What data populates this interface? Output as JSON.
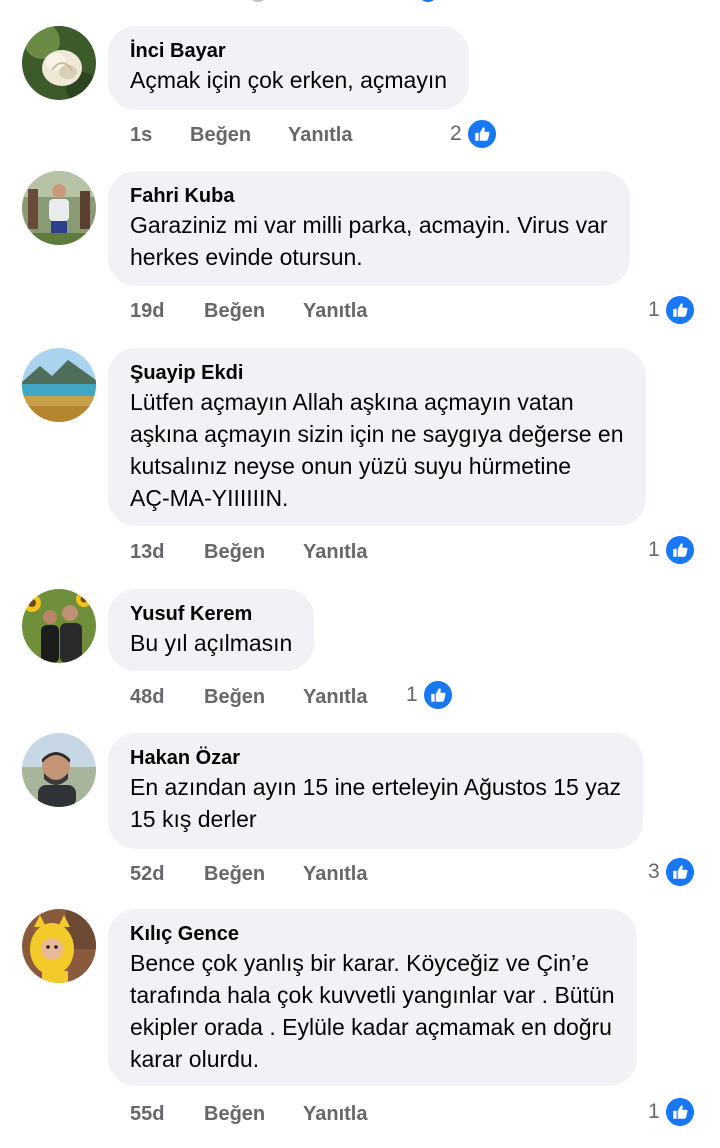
{
  "actions": {
    "like_label": "Beğen",
    "reply_label": "Yanıtla"
  },
  "colors": {
    "bubble_bg": "#f0f2f5",
    "meta_text": "#65676b",
    "like_blue": "#1877f2"
  },
  "comments": [
    {
      "author": "İnci Bayar",
      "avatar_icon": "rose-avatar",
      "lines": [
        "Açmak için çok erken, açmayın"
      ],
      "time": "1s",
      "reactions": "2"
    },
    {
      "author": "Fahri Kuba",
      "avatar_icon": "man-in-garden-avatar",
      "lines": [
        "Garaziniz mi var milli parka, acmayin. Virus var",
        "herkes evinde otursun."
      ],
      "time": "19d",
      "reactions": "1"
    },
    {
      "author": "Şuayip Ekdi",
      "avatar_icon": "lake-landscape-avatar",
      "lines": [
        "Lütfen açmayın Allah aşkına açmayın vatan",
        "aşkına açmayın sizin için ne saygıya değerse en",
        "kutsalınız neyse onun yüzü suyu hürmetine",
        "AÇ-MA-YIIIIIIN."
      ],
      "time": "13d",
      "reactions": "1"
    },
    {
      "author": "Yusuf Kerem",
      "avatar_icon": "sunflower-couple-avatar",
      "lines": [
        "Bu yıl açılmasın"
      ],
      "time": "48d",
      "reactions": "1"
    },
    {
      "author": "Hakan Özar",
      "avatar_icon": "man-selfie-avatar",
      "lines": [
        "En azından ayın 15 ine erteleyin Ağustos 15 yaz",
        "15 kış derler"
      ],
      "time": "52d",
      "reactions": "3"
    },
    {
      "author": "Kılıç Gence",
      "avatar_icon": "child-yellow-costume-avatar",
      "lines": [
        "Bence çok yanlış  bir karar. Köyceğiz ve  Çin’e",
        "tarafında hala çok kuvvetli yangınlar var . Bütün",
        "ekipler orada . Eylüle kadar açmamak en doğru",
        "karar olurdu."
      ],
      "time": "55d",
      "reactions": "1"
    }
  ]
}
